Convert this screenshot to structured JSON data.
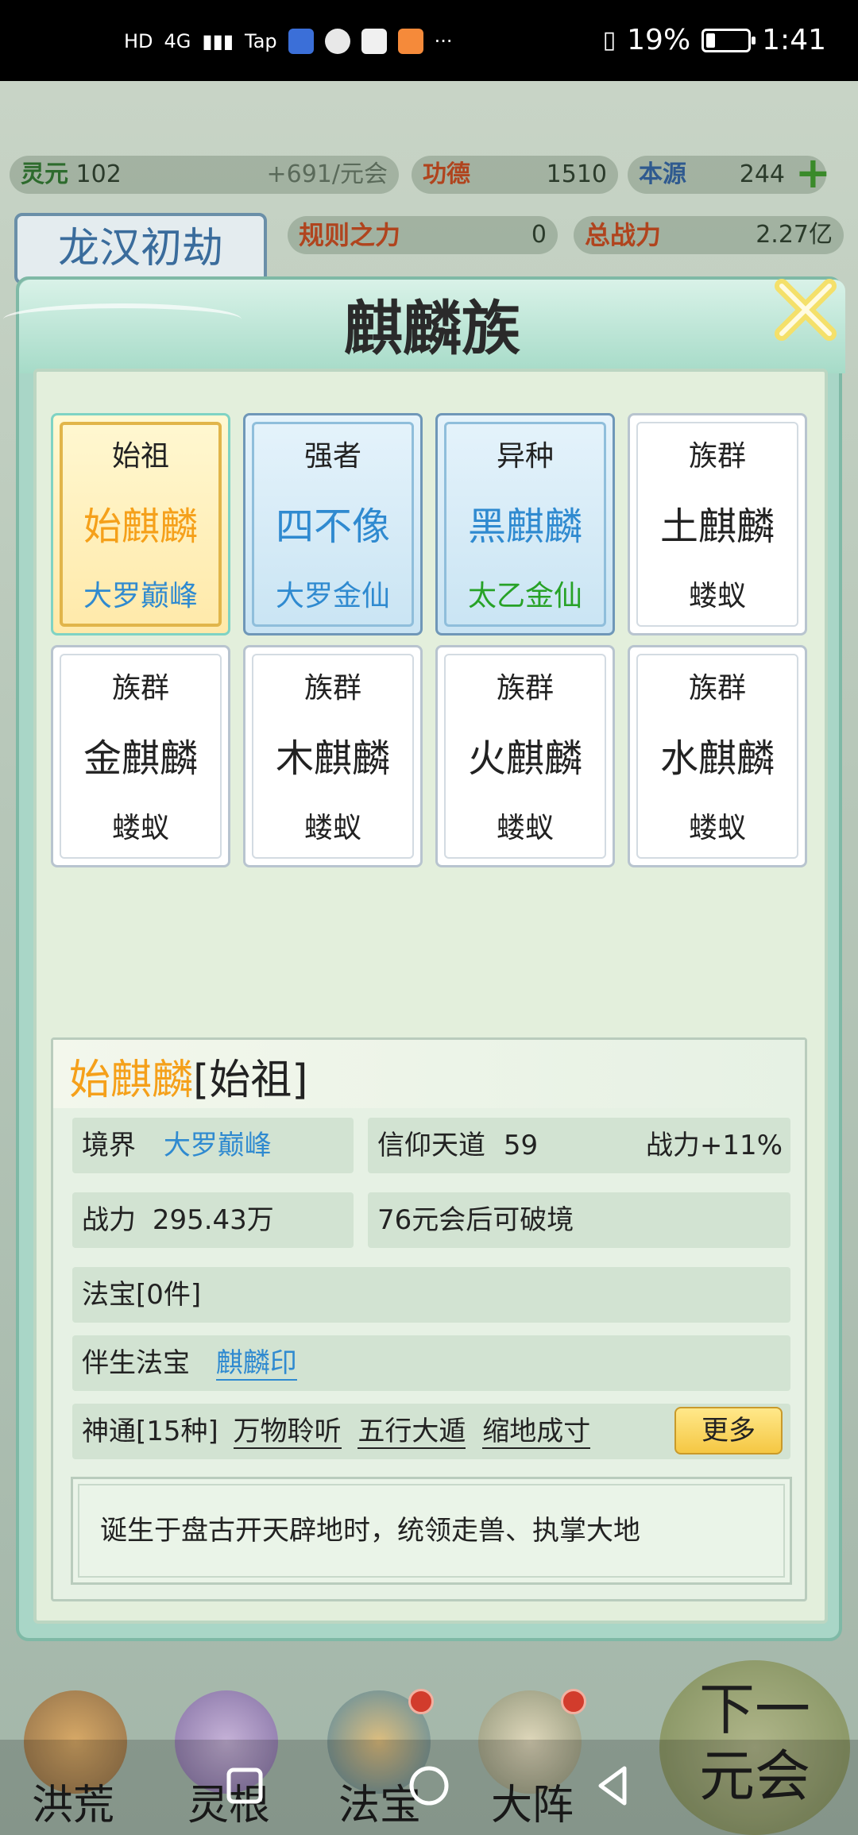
{
  "status_bar": {
    "network_labels": [
      "HD",
      "4G",
      "Tap"
    ],
    "more": "···",
    "battery": "19%",
    "battery_level": 0.19,
    "time": "1:41"
  },
  "resources": {
    "lingyuan": {
      "label": "灵元",
      "value": "102",
      "rate": "+691/元会"
    },
    "gongde": {
      "label": "功德",
      "value": "1510"
    },
    "benyuan": {
      "label": "本源",
      "value": "244"
    },
    "rule_power": {
      "label": "规则之力",
      "value": "0"
    },
    "total_power": {
      "label": "总战力",
      "value": "2.27亿"
    }
  },
  "chapter": "龙汉初劫",
  "dialog": {
    "title": "麒麟族",
    "cards": [
      {
        "rank": "始祖",
        "name": "始麒麟",
        "realm": "大罗巅峰"
      },
      {
        "rank": "强者",
        "name": "四不像",
        "realm": "大罗金仙"
      },
      {
        "rank": "异种",
        "name": "黑麒麟",
        "realm": "太乙金仙"
      },
      {
        "rank": "族群",
        "name": "土麒麟",
        "realm": "蝼蚁"
      },
      {
        "rank": "族群",
        "name": "金麒麟",
        "realm": "蝼蚁"
      },
      {
        "rank": "族群",
        "name": "木麒麟",
        "realm": "蝼蚁"
      },
      {
        "rank": "族群",
        "name": "火麒麟",
        "realm": "蝼蚁"
      },
      {
        "rank": "族群",
        "name": "水麒麟",
        "realm": "蝼蚁"
      }
    ],
    "detail": {
      "name": "始麒麟",
      "rank_tag": "[始祖]",
      "realm_label": "境界",
      "realm_value": "大罗巅峰",
      "faith_label": "信仰天道",
      "faith_value": "59",
      "faith_bonus": "战力+11%",
      "power_label": "战力",
      "power_value": "295.43万",
      "breakthrough": "76元会后可破境",
      "treasure": "法宝[0件]",
      "natal_label": "伴生法宝",
      "natal_value": "麒麟印",
      "skills_label": "神通[15种]",
      "skills": [
        "万物聆听",
        "五行大遁",
        "缩地成寸"
      ],
      "more_button": "更多",
      "description": "诞生于盘古开天辟地时，统领走兽、执掌大地"
    }
  },
  "game_nav": {
    "items": [
      "洪荒",
      "灵根",
      "法宝",
      "大阵"
    ],
    "next": "下一元会"
  },
  "colors": {
    "orange": "#f5a01a",
    "blue": "#2f8ad0",
    "green": "#27a227"
  }
}
